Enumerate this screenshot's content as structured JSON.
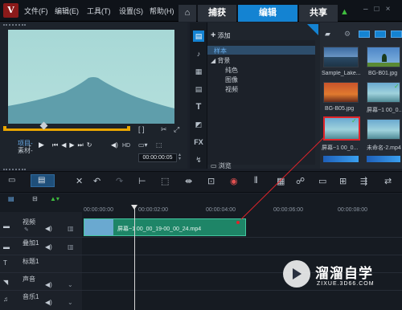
{
  "menubar": {
    "items": [
      "文件(F)",
      "编辑(E)",
      "工具(T)",
      "设置(S)",
      "帮助(H)"
    ],
    "tabs": {
      "capture": "捕获",
      "edit": "编辑",
      "share": "共享"
    }
  },
  "preview": {
    "project_label": "项目-",
    "material_label": "素材-",
    "timecode": "00:00:00:05"
  },
  "library": {
    "add_label": "添加",
    "tree": {
      "sample": "样本",
      "background": "背景",
      "solid_color": "纯色",
      "image": "图像",
      "video": "视频"
    },
    "browse_label": "浏览",
    "thumbs": [
      "Sample_Lake...",
      "BG-B01.jpg",
      "BG-B05.jpg",
      "屏幕~1 00_0...",
      "屏幕~1 00_0...",
      "未命名-2.mp4"
    ]
  },
  "timeline": {
    "ruler": [
      "00:00:00:00",
      "00:00:02:00",
      "00:00:04:00",
      "00:00:06:00",
      "00:00:08:00"
    ],
    "tracks": [
      "视频",
      "叠加1",
      "标题1",
      "声音",
      "音乐1"
    ],
    "clip_label": "屏幕~1 00_00_19-00_00_24.mp4"
  },
  "watermark": {
    "title": "溜溜自学",
    "url": "ZIXUE.3D66.COM"
  },
  "colors": {
    "accent": "#1483d2",
    "clip": "#1e8567",
    "scrub": "#e9a500"
  }
}
